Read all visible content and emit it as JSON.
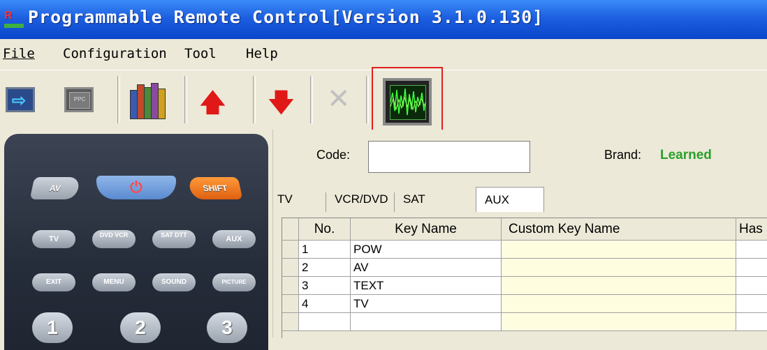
{
  "window": {
    "title": "Programmable Remote Control[Version 3.1.0.130]",
    "icon": "remote-app-icon"
  },
  "menu": [
    {
      "label": "File"
    },
    {
      "label": "Configuration"
    },
    {
      "label": "Tool"
    },
    {
      "label": "Help"
    }
  ],
  "toolbar": {
    "buttons": [
      {
        "name": "send-to-remote-icon"
      },
      {
        "name": "chip-icon",
        "text": "PPC"
      },
      {
        "name": "library-books-icon"
      },
      {
        "name": "move-up-icon"
      },
      {
        "name": "move-down-icon"
      },
      {
        "name": "delete-icon"
      },
      {
        "name": "waveform-learn-icon"
      }
    ]
  },
  "remote": {
    "top_row": [
      "AV",
      "SHIFT"
    ],
    "mode_row": [
      "TV",
      "DVD VCR",
      "SAT DTT",
      "AUX"
    ],
    "func_row": [
      "EXIT",
      "MENU",
      "SOUND",
      "PICTURE"
    ],
    "num_row": [
      "1",
      "2",
      "3"
    ]
  },
  "form": {
    "code_label": "Code:",
    "code_value": "",
    "brand_label": "Brand:",
    "brand_value": "Learned"
  },
  "tabs": [
    {
      "label": "TV"
    },
    {
      "label": "VCR/DVD"
    },
    {
      "label": "SAT"
    },
    {
      "label": "AUX",
      "active": true
    }
  ],
  "table": {
    "headers": [
      "No.",
      "Key Name",
      "Custom Key Name",
      "Has"
    ],
    "rows": [
      {
        "no": "1",
        "key": "POW",
        "custom": "",
        "has": ""
      },
      {
        "no": "2",
        "key": "AV",
        "custom": "",
        "has": ""
      },
      {
        "no": "3",
        "key": "TEXT",
        "custom": "",
        "has": ""
      },
      {
        "no": "4",
        "key": "TV",
        "custom": "",
        "has": ""
      }
    ]
  },
  "colors": {
    "title_bar": "#0a46c9",
    "brand_value": "#2aa02a",
    "highlight": "#e02020",
    "custom_cell": "#fefde0"
  }
}
